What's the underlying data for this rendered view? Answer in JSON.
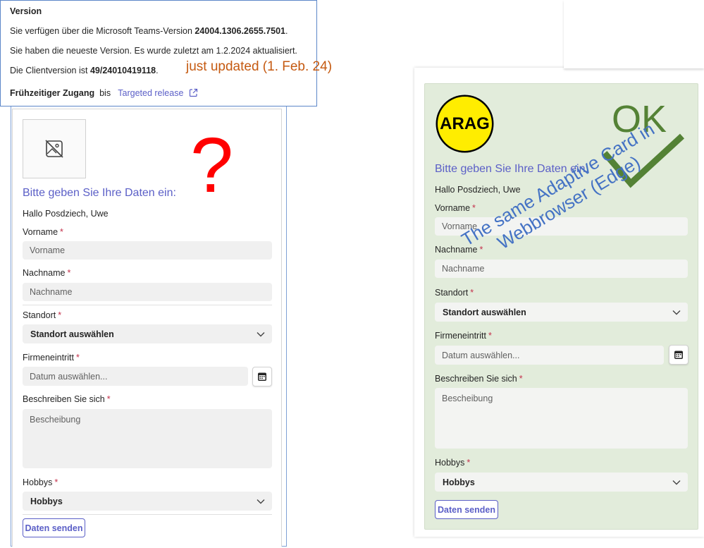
{
  "version_popup": {
    "title": "Version",
    "line1_prefix": "Sie verfügen über die Microsoft Teams-Version ",
    "line1_version": "24004.1306.2655.7501",
    "line1_suffix": ".",
    "line2": "Sie haben die neueste Version. Es wurde zuletzt am 1.2.2024 aktualisiert.",
    "line3_prefix": "Die Clientversion ist ",
    "line3_version": "49/24010419118",
    "line3_suffix": ".",
    "early_access_label": "Frühzeitiger Zugang",
    "early_access_until": "bis",
    "early_access_link": "Targeted release"
  },
  "annotation_updated": "just updated (1. Feb. 24)",
  "annotation_question": "?",
  "annotation_ok": "OK",
  "annotation_webbrowser_line1": "The same Adaptive Card in",
  "annotation_webbrowser_line2": "Webbrowser (Edge)",
  "form": {
    "heading": "Bitte geben Sie Ihre Daten ein:",
    "greeting": "Hallo Posdziech, Uwe",
    "required_mark": "*",
    "vorname_label": "Vorname",
    "vorname_placeholder": "Vorname",
    "nachname_label": "Nachname",
    "nachname_placeholder": "Nachname",
    "standort_label": "Standort",
    "standort_value": "Standort auswählen",
    "firmeneintritt_label": "Firmeneintritt",
    "firmeneintritt_placeholder": "Datum auswählen...",
    "beschreibung_label": "Beschreiben Sie sich",
    "beschreibung_placeholder": "Bescheibung",
    "hobbys_label": "Hobbys",
    "hobbys_value": "Hobbys",
    "submit_label": "Daten senden"
  },
  "logo_text": "ARAG",
  "colors": {
    "teams_accent": "#5b5fc7",
    "required": "#c4314b",
    "web_card_bg": "#e2ecdb",
    "annotation_orange": "#c55a11",
    "annotation_red": "#ff0000",
    "annotation_green": "#548235",
    "annotation_blue": "#4472c4",
    "logo_yellow": "#ffed00"
  }
}
